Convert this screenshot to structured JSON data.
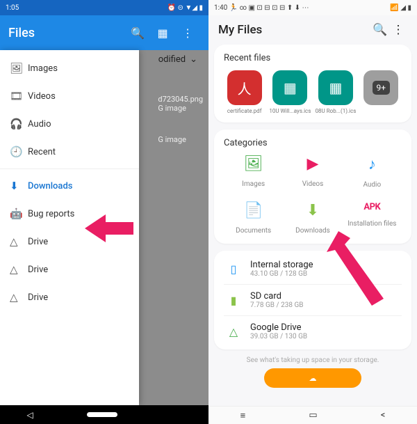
{
  "left": {
    "status": {
      "time": "1:05",
      "icons": "⏰ ⊝ ▼◢ ▮"
    },
    "appbar": {
      "title": "Files"
    },
    "sort_label": "odified",
    "back_file": {
      "name": "d723045.png",
      "type": "G image"
    },
    "back_file2_type": "G image",
    "drawer": [
      {
        "icon": "🖼",
        "label": "Images"
      },
      {
        "icon": "🎞",
        "label": "Videos"
      },
      {
        "icon": "🎧",
        "label": "Audio"
      },
      {
        "icon": "🕘",
        "label": "Recent"
      }
    ],
    "drawer2": [
      {
        "icon": "⬇",
        "label": "Downloads",
        "selected": true
      },
      {
        "icon": "🤖",
        "label": "Bug reports"
      },
      {
        "icon": "△",
        "label": "Drive"
      },
      {
        "icon": "△",
        "label": "Drive"
      },
      {
        "icon": "△",
        "label": "Drive"
      }
    ]
  },
  "right": {
    "status": {
      "time": "1:40",
      "left_icons": "🏃 ∞ ▣ ⊡ ⊟ ⊡ ⊟ ⬆ ⬇ ⋯",
      "right_icons": "📶 ◢ ▮"
    },
    "title": "My Files",
    "recent_title": "Recent files",
    "recents": [
      {
        "label": "certificate.pdf",
        "thumb_class": "thumb-red",
        "glyph": "人"
      },
      {
        "label": "10U Will...ays.ics",
        "thumb_class": "thumb-teal",
        "glyph": "▦"
      },
      {
        "label": "08U Rob...(1).ics",
        "thumb_class": "thumb-teal",
        "glyph": "▦"
      },
      {
        "label": "",
        "thumb_class": "thumb-grey",
        "glyph": "9+"
      }
    ],
    "categories_title": "Categories",
    "categories": [
      {
        "icon": "🖼",
        "label": "Images",
        "cls": "ic-green"
      },
      {
        "icon": "▶",
        "label": "Videos",
        "cls": "ic-pink"
      },
      {
        "icon": "♪",
        "label": "Audio",
        "cls": "ic-blue"
      },
      {
        "icon": "📄",
        "label": "Documents",
        "cls": "ic-orange"
      },
      {
        "icon": "⬇",
        "label": "Downloads",
        "cls": "ic-lgreen"
      },
      {
        "icon": "APK",
        "label": "Installation files",
        "cls": "ic-apk"
      }
    ],
    "storages": [
      {
        "icon": "▯",
        "name": "Internal storage",
        "sub": "43.10 GB / 128 GB",
        "cls": "st-blue"
      },
      {
        "icon": "▮",
        "name": "SD card",
        "sub": "7.78 GB / 238 GB",
        "cls": "st-lgreen"
      },
      {
        "icon": "△",
        "name": "Google Drive",
        "sub": "39.03 GB / 130 GB",
        "cls": "st-gd"
      }
    ],
    "hint": "See what's taking up space in your storage."
  }
}
